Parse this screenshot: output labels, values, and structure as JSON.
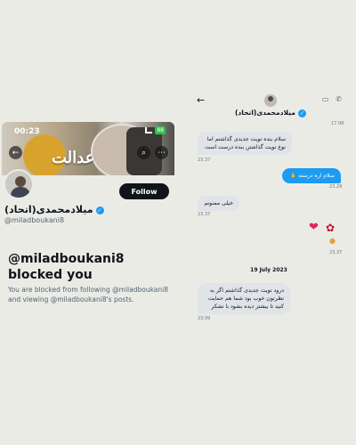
{
  "profile": {
    "status_time": "00:23",
    "battery": "88",
    "banner_text": "عدالت",
    "follow_label": "Follow",
    "display_name": "میلادمحمدی(اتحاد)",
    "handle": "@miladboukani8",
    "blocked_title": "@miladboukani8 blocked you",
    "blocked_desc": "You are blocked from following @miladboukani8 and viewing @miladboukani8's posts."
  },
  "chat": {
    "name": "میلادمحمدی(اتحاد)",
    "header_time": "17.08",
    "messages": [
      {
        "text": "سلام بنده تویت جدیدی گذاشتم اما نوع تویت گذاشتن بنده درست است",
        "time": "23.37"
      },
      {
        "text": "سلام اره درسته 🙏",
        "time": "23.29"
      },
      {
        "text": "خیلی ممنونم",
        "time": "23.37"
      },
      {
        "text": "",
        "time": "23.37"
      },
      {
        "text": "درود تویت جدیدی گذاشتم اگر به نظرتون خوب بود شما هم حمایت کنید تا بیشتر دیده بشود با تشکر",
        "time": "23.09"
      }
    ],
    "date_separator": "19 July 2023"
  },
  "icons": {
    "back": "arrow-left-icon",
    "search": "search-icon",
    "more": "more-icon",
    "video": "video-icon",
    "phone": "phone-icon",
    "verified": "verified-badge-icon",
    "heart": "heart-icon",
    "rose": "rose-icon",
    "thumb": "thumbs-up-icon"
  },
  "colors": {
    "twitter_blue": "#1d9bf0",
    "follow_bg": "#0f1419",
    "page_bg": "#ebebe6",
    "incoming_bubble": "#e0e4e8"
  }
}
